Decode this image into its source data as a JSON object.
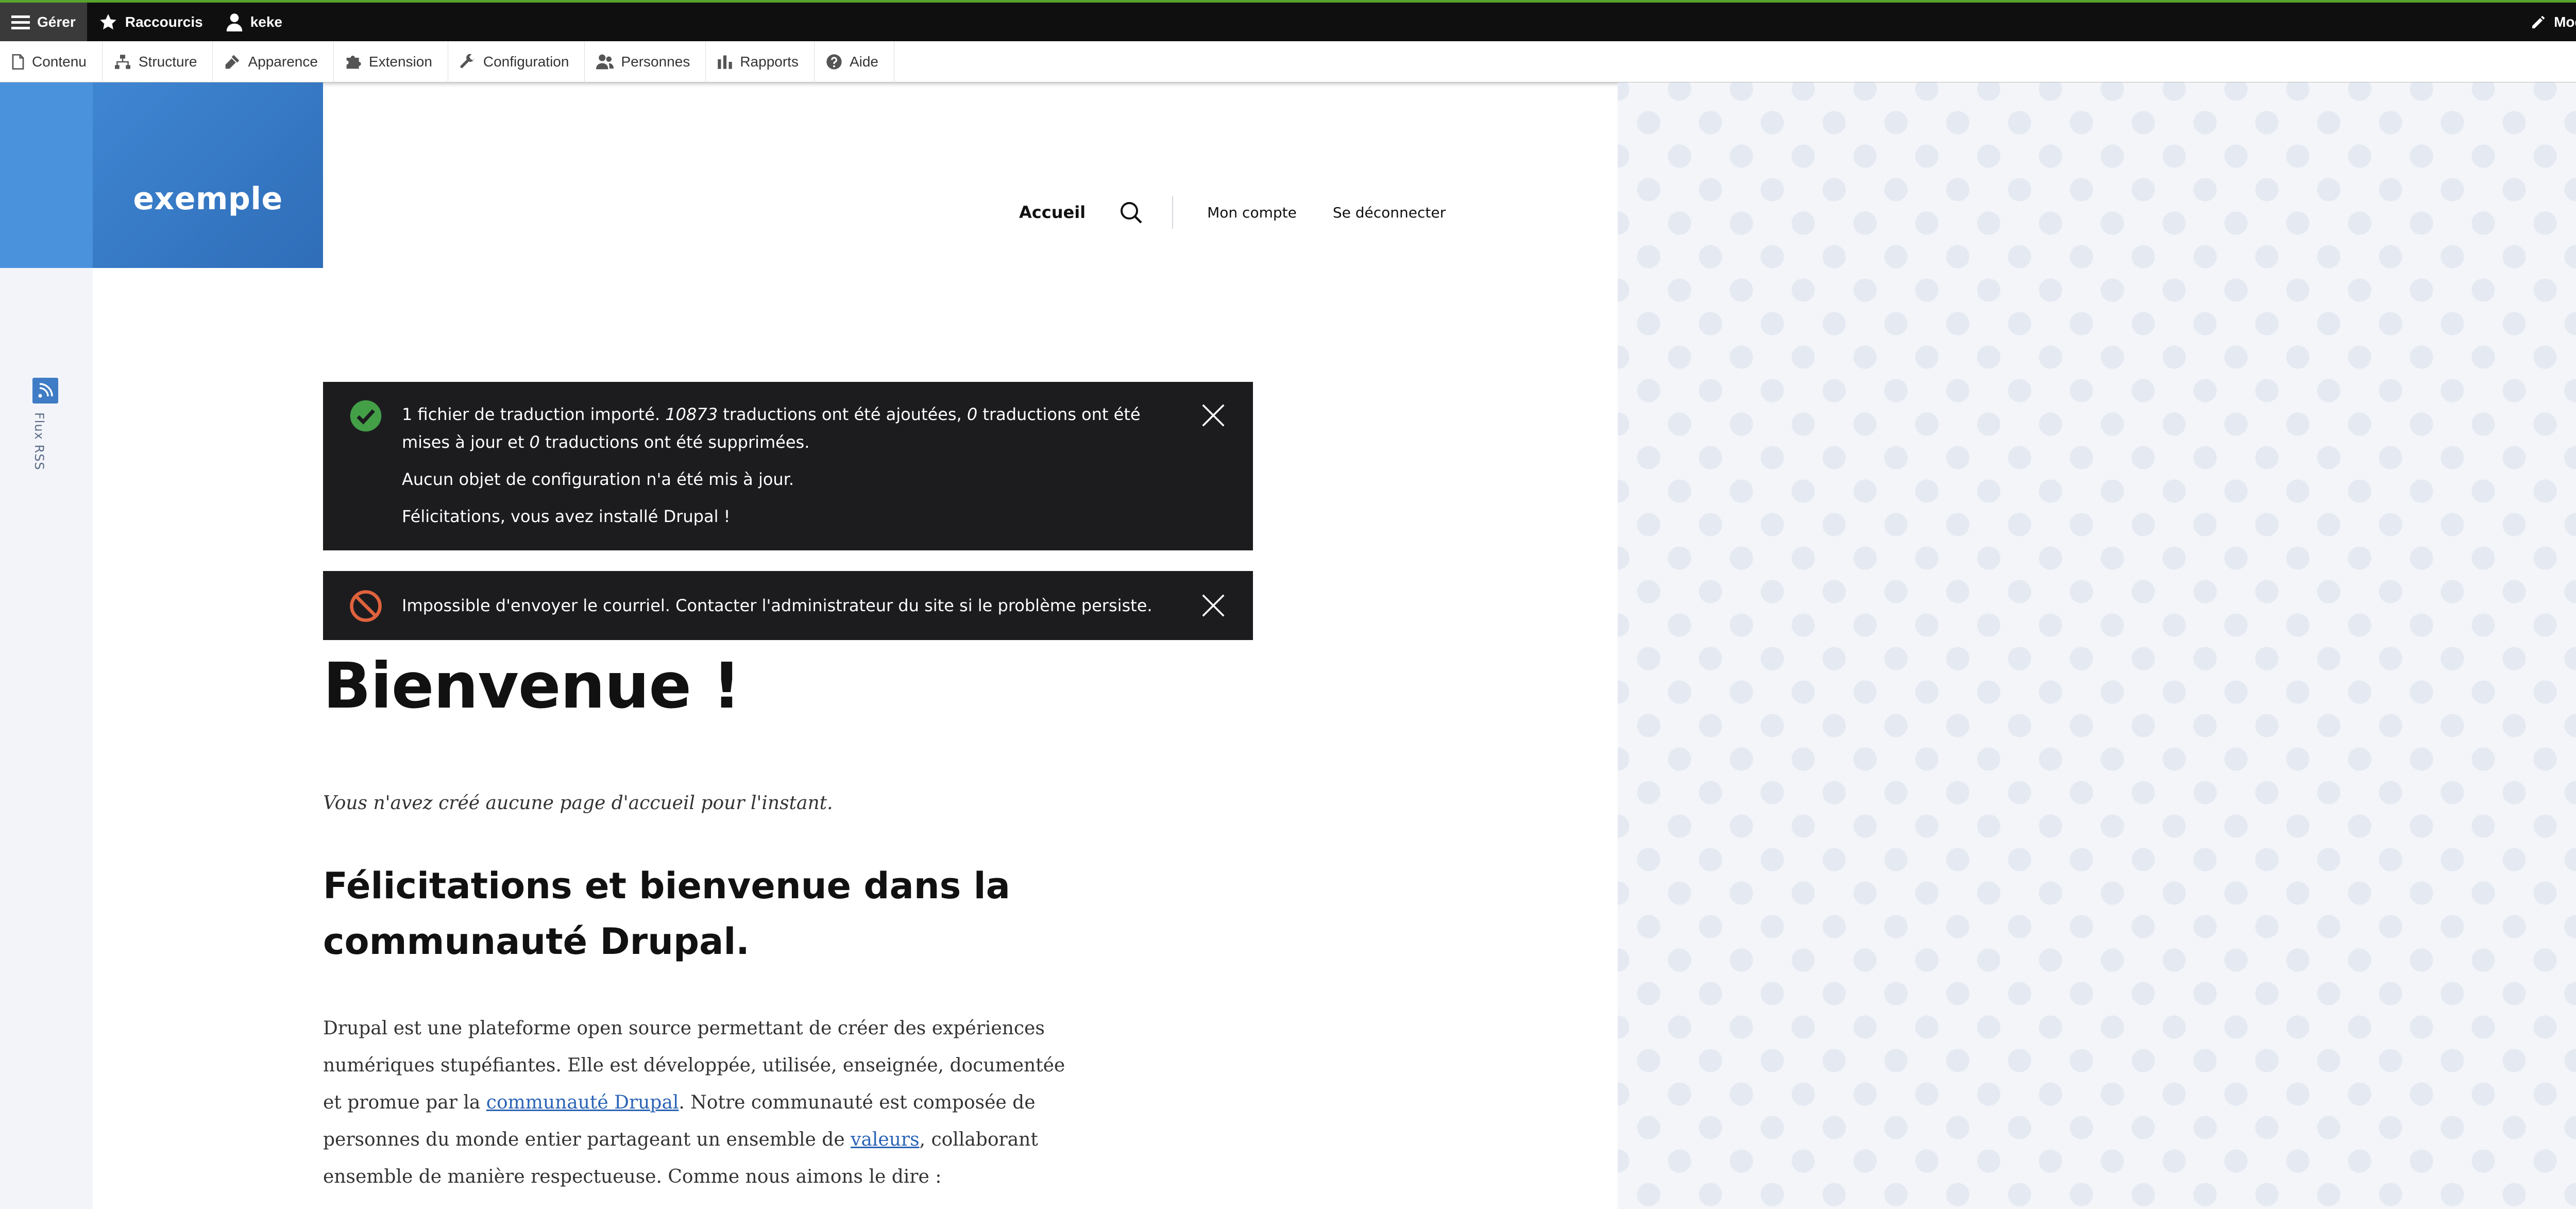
{
  "toolbar": {
    "manage": "Gérer",
    "shortcuts": "Raccourcis",
    "user": "keke",
    "edit": "Modifier"
  },
  "tray": {
    "items": [
      {
        "label": "Contenu",
        "icon": "file-icon"
      },
      {
        "label": "Structure",
        "icon": "sitemap-icon"
      },
      {
        "label": "Apparence",
        "icon": "brush-icon"
      },
      {
        "label": "Extension",
        "icon": "puzzle-icon"
      },
      {
        "label": "Configuration",
        "icon": "wrench-icon"
      },
      {
        "label": "Personnes",
        "icon": "people-icon"
      },
      {
        "label": "Rapports",
        "icon": "bar-chart-icon"
      },
      {
        "label": "Aide",
        "icon": "help-icon"
      }
    ]
  },
  "site": {
    "name": "exemple"
  },
  "nav": {
    "home": "Accueil",
    "account": "Mon compte",
    "logout": "Se déconnecter"
  },
  "feed": {
    "label": "Flux RSS"
  },
  "messages": {
    "status": {
      "part1": "1 fichier de traduction importé. ",
      "added_count": "10873",
      "part2": " traductions ont été ajoutées, ",
      "updated_count": "0",
      "part3": " traductions ont été mises à jour et ",
      "deleted_count": "0",
      "part4": " traductions ont été supprimées.",
      "line2": "Aucun objet de configuration n'a été mis à jour.",
      "line3": "Félicitations, vous avez installé Drupal !"
    },
    "error": {
      "text": "Impossible d'envoyer le courriel. Contacter l'administrateur du site si le problème persiste."
    }
  },
  "content": {
    "title": "Bienvenue !",
    "intro": "Vous n'avez créé aucune page d'accueil pour l'instant.",
    "heading": "Félicitations et bienvenue dans la communauté Drupal.",
    "p1": "Drupal est une plateforme open source permettant de créer des expériences numériques stupéfiantes. Elle est développée, utilisée, enseignée, documentée et promue par la ",
    "link1": "communauté Drupal",
    "p2": ". Notre communauté est composée de personnes du monde entier partageant un ensemble de ",
    "link2": "valeurs",
    "p3": ", collaborant ensemble de manière respectueuse. Comme nous aimons le dire :"
  },
  "colors": {
    "toolbar_bg": "#0f0f0f",
    "toolbar_accent": "#57a52c",
    "brand_blue": "#2f6db8",
    "message_bg": "#1c1c1f",
    "success": "#43a047",
    "error": "#e0623d",
    "link": "#2b64b5"
  }
}
